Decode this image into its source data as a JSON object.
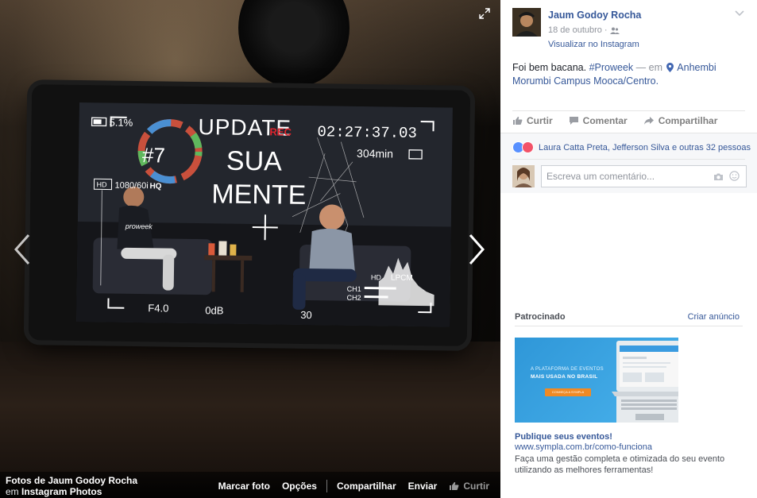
{
  "photo": {
    "overlay": {
      "battery_pct": "5.1%",
      "rec_label": "REC",
      "timecode": "02:27:37.03",
      "remaining": "304min",
      "resolution": "1080/60i",
      "hq": "HQ",
      "hd": "HD",
      "aperture": "F4.0",
      "gain": "0dB",
      "shutter": "30",
      "audio_fmt": "LPCM",
      "ch1": "CH1",
      "ch2": "CH2",
      "sign_number": "#7",
      "sign_line1": "UPDATE",
      "sign_line2": "SUA",
      "sign_line3": "MENTE",
      "shirt_text": "proweek"
    },
    "credit_prefix": "Fotos de ",
    "credit_owner": "Jaum Godoy Rocha",
    "credit_in": "em ",
    "credit_album": "Instagram Photos"
  },
  "photo_actions": {
    "tag": "Marcar foto",
    "options": "Opções",
    "share": "Compartilhar",
    "send": "Enviar",
    "like": "Curtir"
  },
  "post": {
    "author": "Jaum Godoy Rocha",
    "date": "18 de outubro",
    "via": "Visualizar no Instagram",
    "text": "Foi bem bacana.",
    "hashtag": "#Proweek",
    "dash_in": "— em",
    "place": "Anhembi Morumbi Campus Mooca/Centro."
  },
  "ufi": {
    "like": "Curtir",
    "comment": "Comentar",
    "share": "Compartilhar",
    "reactions_text": "Laura Catta Preta, Jefferson Silva e outras 32 pessoas",
    "comment_placeholder": "Escreva um comentário..."
  },
  "ads": {
    "sponsored": "Patrocinado",
    "create_ad": "Criar anúncio",
    "banner_line1": "A PLATAFORMA DE EVENTOS",
    "banner_line2": "MAIS USADA NO BRASIL",
    "banner_button": "CONHEÇA A SYMPLA",
    "title": "Publique seus eventos!",
    "url": "www.sympla.com.br/como-funciona",
    "description": "Faça uma gestão completa e otimizada do seu evento utilizando as melhores ferramentas!"
  },
  "colors": {
    "link": "#365899",
    "like_blue": "#5890ff",
    "love_red": "#f25268",
    "rec_red": "#e0242d",
    "ad_orange": "#f08a24"
  }
}
